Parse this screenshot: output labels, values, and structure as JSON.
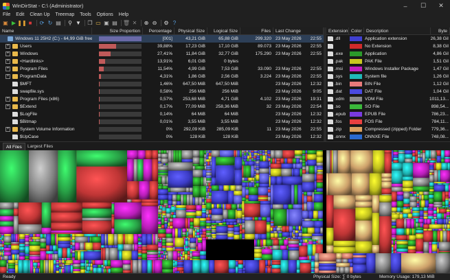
{
  "window": {
    "title": "WinDirStat - C:\\ (Administrator)"
  },
  "menu": [
    "File",
    "Edit",
    "Clean Up",
    "Treemap",
    "Tools",
    "Options",
    "Help"
  ],
  "toolbar": [
    {
      "name": "open-icon",
      "glyph": "▣",
      "color": "#d98a3a"
    },
    {
      "name": "play-icon",
      "glyph": "▶",
      "color": "#3bbf3b"
    },
    {
      "name": "pause-icon",
      "glyph": "❚❚",
      "color": "#e0a030"
    },
    {
      "name": "stop-icon",
      "glyph": "■",
      "color": "#d83a3a"
    },
    {
      "name": "refresh-icon",
      "glyph": "⟳",
      "color": "#5aa0e0"
    },
    {
      "name": "refresh-all-icon",
      "glyph": "↻",
      "color": "#5aa0e0"
    },
    {
      "name": "save-icon",
      "glyph": "▤",
      "color": "#bbbbbb"
    },
    {
      "name": "search-icon",
      "glyph": "⚲",
      "color": "#dddddd"
    },
    {
      "name": "filter-icon",
      "glyph": "▼",
      "color": "#dddddd"
    },
    {
      "name": "copy-icon",
      "glyph": "❐",
      "color": "#bbbbbb"
    },
    {
      "name": "explorer-icon",
      "glyph": "▭",
      "color": "#e8b84a"
    },
    {
      "name": "command-icon",
      "glyph": "▣",
      "color": "#bbbbbb"
    },
    {
      "name": "properties-icon",
      "glyph": "▤",
      "color": "#bbbbbb"
    },
    {
      "name": "trash-icon",
      "glyph": "🗑",
      "color": "#888888"
    },
    {
      "name": "delete-icon",
      "glyph": "✕",
      "color": "#888888"
    },
    {
      "name": "zoom-in-icon",
      "glyph": "⊕",
      "color": "#dddddd"
    },
    {
      "name": "zoom-out-icon",
      "glyph": "⊖",
      "color": "#dddddd"
    },
    {
      "name": "settings-icon",
      "glyph": "⚙",
      "color": "#dddddd"
    },
    {
      "name": "help-icon",
      "glyph": "?",
      "color": "#5aa0e0"
    }
  ],
  "tree": {
    "headers": [
      "Name",
      "Size Proportion",
      "Percentage",
      "Physical Size",
      "Logical Size",
      "Files",
      "Last Change"
    ],
    "rows": [
      {
        "name": "Windows 11 25H2 (C:) - 64,99 GiB free ...",
        "icon": "drive",
        "expander": "",
        "indent": 0,
        "pct": "[001]",
        "phys": "43,21 GiB",
        "log": "65,88 GiB",
        "files": "299.320",
        "date": "23 May 2026",
        "time": "22:55",
        "fill": 1.0,
        "sel": true
      },
      {
        "name": "Users",
        "icon": "folder",
        "expander": "+",
        "indent": 1,
        "pct": "39,88%",
        "phys": "17,23 GiB",
        "log": "17,10 GiB",
        "files": "89.073",
        "date": "23 May 2026",
        "time": "22:55",
        "fill": 0.3988
      },
      {
        "name": "Windows",
        "icon": "folder",
        "expander": "+",
        "indent": 1,
        "pct": "27,41%",
        "phys": "11,84 GiB",
        "log": "32,77 GiB",
        "files": "175.290",
        "date": "23 May 2026",
        "time": "22:55",
        "fill": 0.2741
      },
      {
        "name": "<Hardlinks>",
        "icon": "folder",
        "expander": "+",
        "indent": 1,
        "pct": "13,91%",
        "phys": "6,01 GiB",
        "log": "0 bytes",
        "files": "",
        "date": "",
        "time": "",
        "fill": 0.1391
      },
      {
        "name": "Program Files",
        "icon": "folder",
        "expander": "+",
        "indent": 1,
        "pct": "11,54%",
        "phys": "4,99 GiB",
        "log": "7,53 GiB",
        "files": "33.090",
        "date": "23 May 2026",
        "time": "22:55",
        "fill": 0.1154
      },
      {
        "name": "ProgramData",
        "icon": "folder",
        "expander": "+",
        "indent": 1,
        "pct": "4,31%",
        "phys": "1,86 GiB",
        "log": "2,56 GiB",
        "files": "3.224",
        "date": "23 May 2026",
        "time": "22:55",
        "fill": 0.0431
      },
      {
        "name": "$MFT",
        "icon": "file",
        "expander": "",
        "indent": 1,
        "pct": "1,46%",
        "phys": "647,50 MiB",
        "log": "647,50 MiB",
        "files": "",
        "date": "23 May 2026",
        "time": "12:32",
        "fill": 0.0146
      },
      {
        "name": "swapfile.sys",
        "icon": "file",
        "expander": "",
        "indent": 1,
        "pct": "0,58%",
        "phys": "256 MiB",
        "log": "256 MiB",
        "files": "",
        "date": "23 May 2026",
        "time": "9:05",
        "fill": 0.0058
      },
      {
        "name": "Program Files (x86)",
        "icon": "folder",
        "expander": "+",
        "indent": 1,
        "pct": "0,57%",
        "phys": "253,68 MiB",
        "log": "4,71 GiB",
        "files": "4.102",
        "date": "23 May 2026",
        "time": "19:31",
        "fill": 0.0057
      },
      {
        "name": "$Extend",
        "icon": "folder",
        "expander": "+",
        "indent": 1,
        "pct": "0,17%",
        "phys": "77,09 MiB",
        "log": "258,36 MiB",
        "files": "32",
        "date": "23 May 2026",
        "time": "22:54",
        "fill": 0.0017
      },
      {
        "name": "$LogFile",
        "icon": "file",
        "expander": "",
        "indent": 1,
        "pct": "0,14%",
        "phys": "64 MiB",
        "log": "64 MiB",
        "files": "",
        "date": "23 May 2026",
        "time": "12:32",
        "fill": 0.0014
      },
      {
        "name": "$Bitmap",
        "icon": "file",
        "expander": "",
        "indent": 1,
        "pct": "0,01%",
        "phys": "3,55 MiB",
        "log": "3,55 MiB",
        "files": "",
        "date": "23 May 2026",
        "time": "12:32",
        "fill": 0.0001
      },
      {
        "name": "System Volume Information",
        "icon": "folder",
        "expander": "+",
        "indent": 1,
        "pct": "0%",
        "phys": "292,09 KiB",
        "log": "285,09 KiB",
        "files": "11",
        "date": "23 May 2026",
        "time": "22:55",
        "fill": 0.0
      },
      {
        "name": "$UpCase",
        "icon": "file",
        "expander": "",
        "indent": 1,
        "pct": "0%",
        "phys": "128 KiB",
        "log": "128 KiB",
        "files": "",
        "date": "23 May 2026",
        "time": "12:32",
        "fill": 0.0
      }
    ]
  },
  "extensions": {
    "headers": [
      "Extension",
      "Color",
      "Description",
      "Byte"
    ],
    "rows": [
      {
        "ext": ".dll",
        "color": "#3f3fd0",
        "desc": "Application extension",
        "size": "26,38 GiI"
      },
      {
        "ext": "",
        "color": "#d02a2a",
        "desc": "No Extension",
        "size": "8,38 GiI"
      },
      {
        "ext": ".exe",
        "color": "#2a9a2a",
        "desc": "Application",
        "size": "4,86 GiI"
      },
      {
        "ext": ".pak",
        "color": "#c8c820",
        "desc": "PAK File",
        "size": "1,51 GiI"
      },
      {
        "ext": ".msi",
        "color": "#c020c0",
        "desc": "Windows Installer Package",
        "size": "1,47 GiI"
      },
      {
        "ext": ".sys",
        "color": "#20b8b8",
        "desc": "System file",
        "size": "1,26 GiI"
      },
      {
        "ext": ".bin",
        "color": "#e87a7a",
        "desc": "BIN File",
        "size": "1,12 GiI"
      },
      {
        "ext": ".dat",
        "color": "#4a4ae0",
        "desc": "DAT File",
        "size": "1,04 GiI"
      },
      {
        "ext": ".vdm",
        "color": "#8a8a8a",
        "desc": "VDM File",
        "size": "1011,13..."
      },
      {
        "ext": ".so",
        "color": "#3ab83a",
        "desc": "SO File",
        "size": "898,54..."
      },
      {
        "ext": ".epub",
        "color": "#7a3ae0",
        "desc": "EPUB File",
        "size": "786,23..."
      },
      {
        "ext": ".fos",
        "color": "#e84040",
        "desc": "FOS File",
        "size": "784,11..."
      },
      {
        "ext": ".zip",
        "color": "#d8a060",
        "desc": "Compressed (zipped) Folder",
        "size": "779,36..."
      },
      {
        "ext": ".onnx",
        "color": "#2a6ad0",
        "desc": "ONNXE File",
        "size": "748,08..."
      }
    ]
  },
  "tabs": [
    "All Files",
    "Largest Files"
  ],
  "status": {
    "left": "Ready",
    "physical": "Physical Size: ∑ 0 bytes",
    "memory": "Memory Usage: 179,13 MiB"
  }
}
